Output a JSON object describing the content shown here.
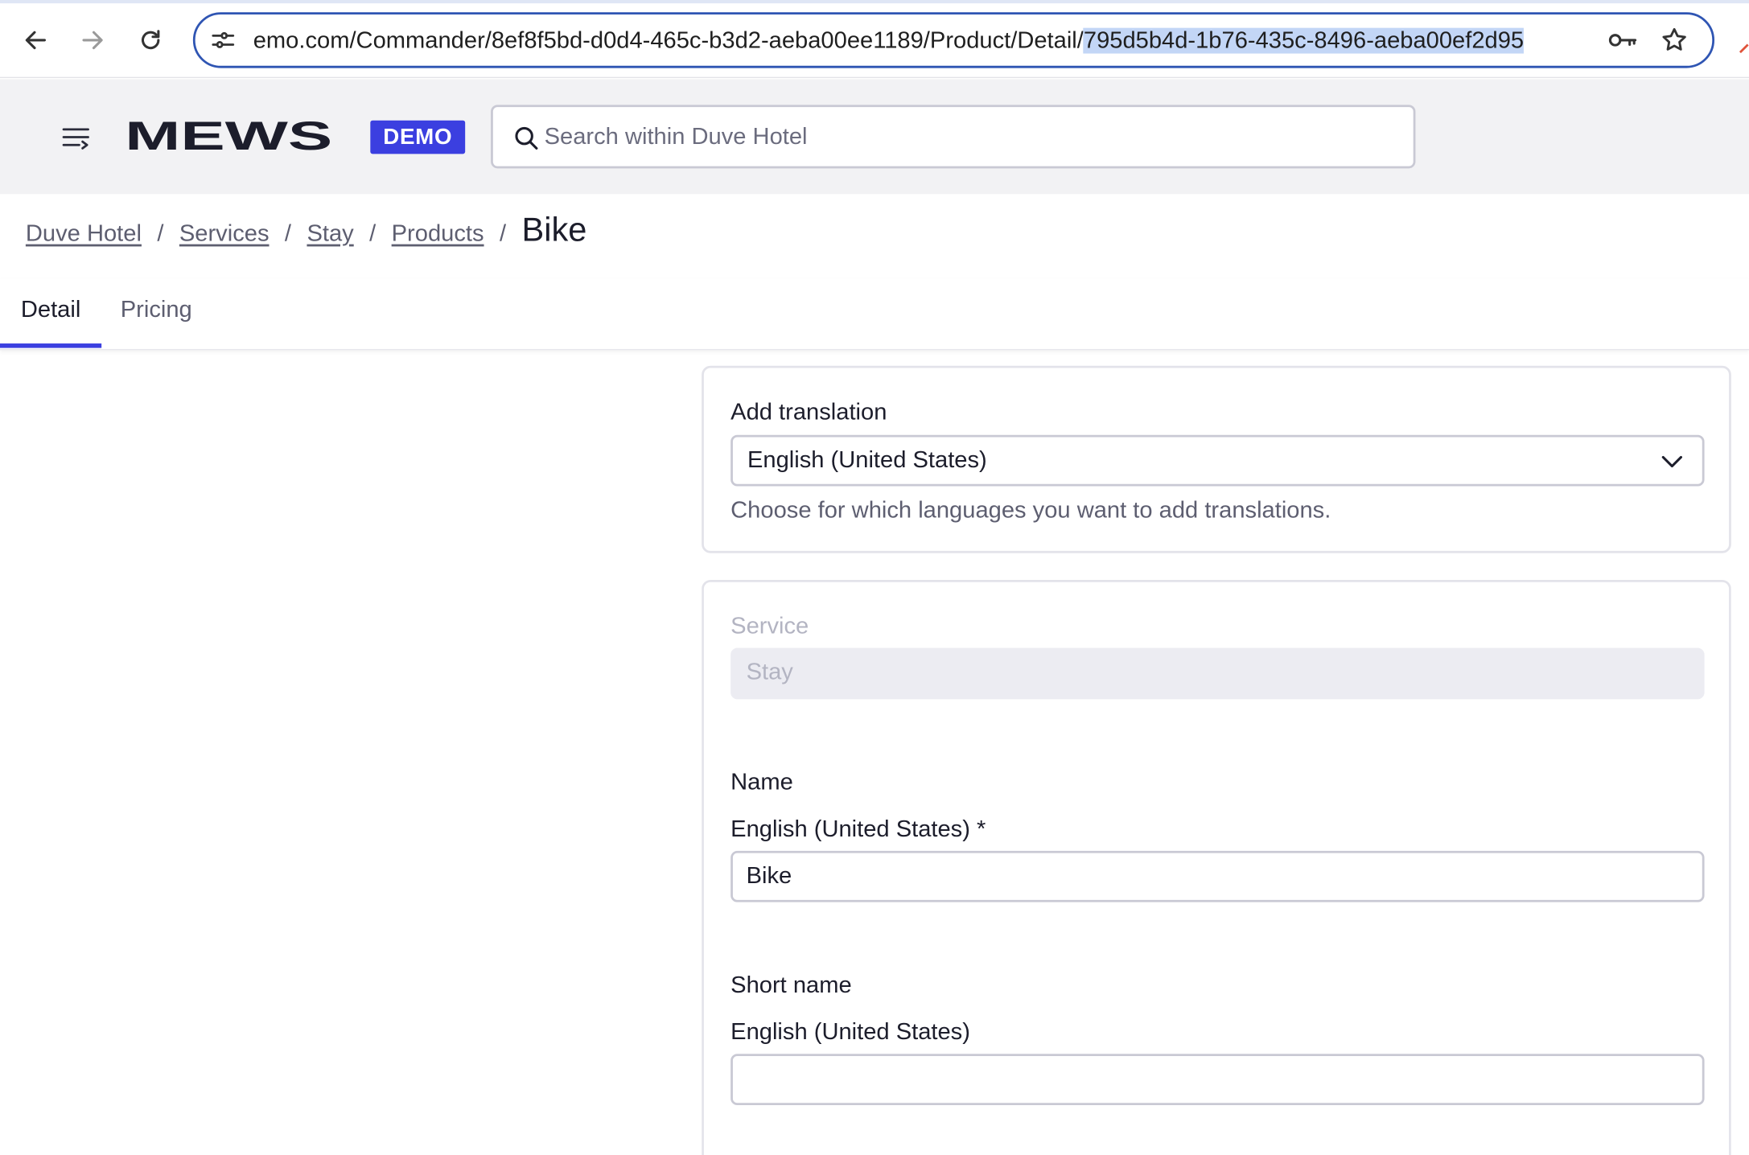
{
  "browser": {
    "url_prefix": "emo.com/Commander/8ef8f5bd-d0d4-465c-b3d2-aeba00ee1189/Product/Detail/",
    "url_selected": "795d5b4d-1b76-435c-8496-aeba00ef2d95"
  },
  "header": {
    "logo_text": "MEWS",
    "badge": "DEMO",
    "search_placeholder": "Search within Duve Hotel",
    "accent_color": "#3b3fe0"
  },
  "breadcrumb": {
    "items": [
      "Duve Hotel",
      "Services",
      "Stay",
      "Products"
    ],
    "separator": "/",
    "current": "Bike"
  },
  "tabs": [
    {
      "label": "Detail",
      "active": true
    },
    {
      "label": "Pricing",
      "active": false
    }
  ],
  "translation_card": {
    "label": "Add translation",
    "selected_language": "English (United States)",
    "hint": "Choose for which languages you want to add translations."
  },
  "main_card": {
    "service_label": "Service",
    "service_value": "Stay",
    "name_label": "Name",
    "name_lang_label": "English (United States) *",
    "name_value": "Bike",
    "short_name_label": "Short name",
    "short_name_lang_label": "English (United States)",
    "short_name_value": ""
  }
}
